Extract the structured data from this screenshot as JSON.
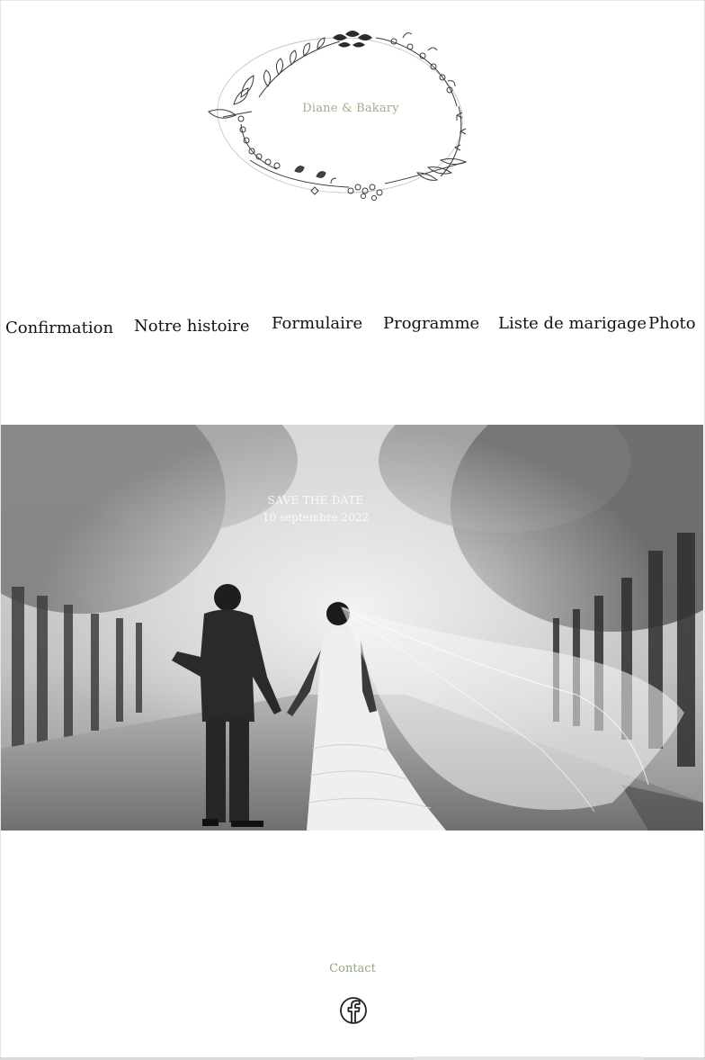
{
  "header": {
    "couple_names": "Diane & Bakary",
    "logo_icon": "floral-wreath-icon"
  },
  "nav": {
    "items": [
      {
        "label": "Confirmation"
      },
      {
        "label": "Notre histoire"
      },
      {
        "label": "Formulaire"
      },
      {
        "label": "Programme"
      },
      {
        "label": "Liste de marigage"
      },
      {
        "label": "Photo"
      }
    ]
  },
  "hero": {
    "title": "SAVE THE DATE",
    "date": "10 septembre 2022"
  },
  "footer": {
    "contact_label": "Contact",
    "social_icon": "facebook-icon"
  },
  "colors": {
    "accent_green": "#9ab08a",
    "text_dark": "#111111"
  }
}
